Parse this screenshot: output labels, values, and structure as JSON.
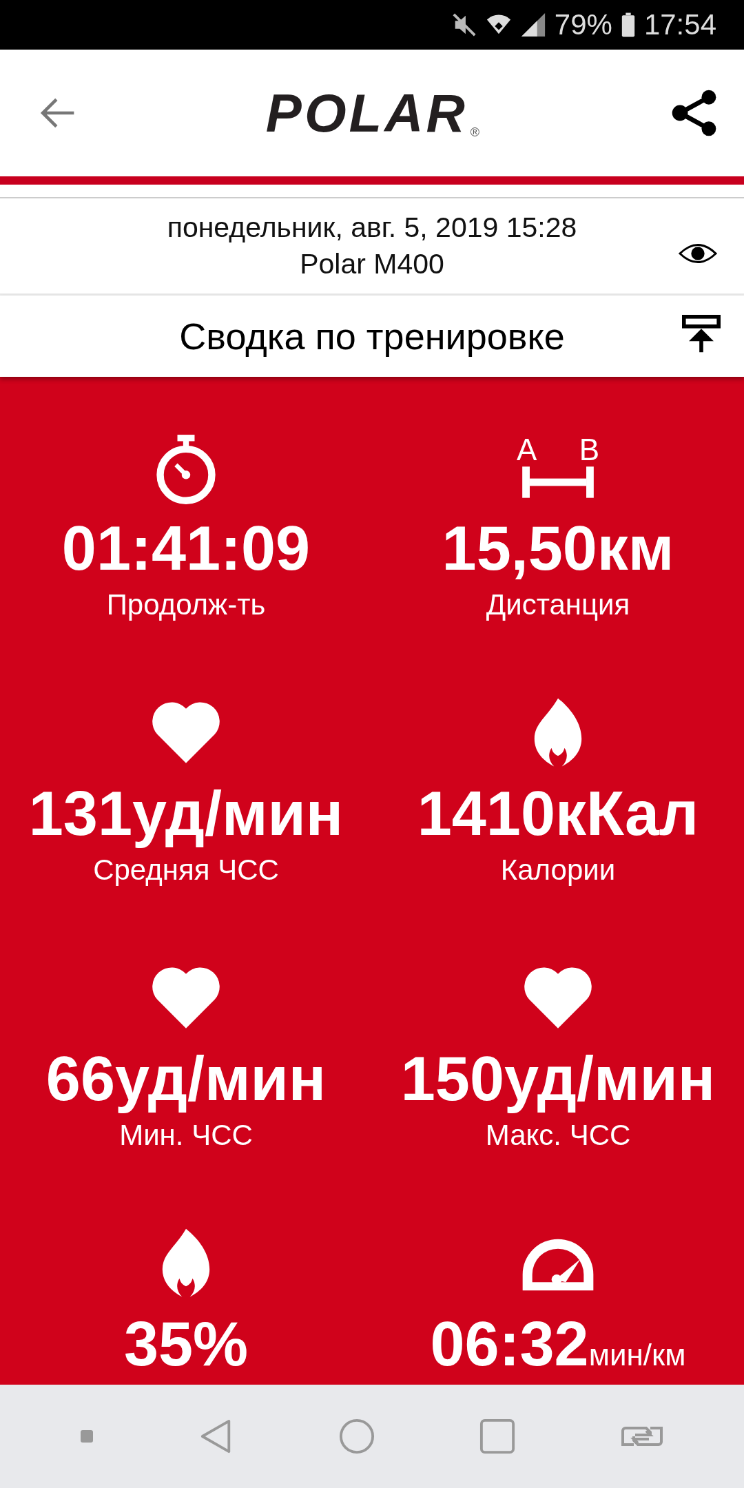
{
  "status_bar": {
    "battery": "79%",
    "time": "17:54"
  },
  "header": {
    "logo": "POLAR",
    "registered": "®"
  },
  "info": {
    "date": "понедельник, авг. 5, 2019 15:28",
    "device": "Polar M400"
  },
  "section": {
    "title": "Сводка по тренировке"
  },
  "distance_icon": {
    "marks": [
      "A",
      "B"
    ]
  },
  "stats": [
    {
      "kind": "stopwatch",
      "value": "01:41:09",
      "label": "Продолж-ть"
    },
    {
      "kind": "distance",
      "value": "15,50км",
      "label": "Дистанция"
    },
    {
      "kind": "heart",
      "value": "131уд/мин",
      "label": "Средняя ЧСС"
    },
    {
      "kind": "flame",
      "value": "1410кКал",
      "label": "Калории"
    },
    {
      "kind": "heart",
      "value": "66уд/мин",
      "label": "Мин. ЧСС"
    },
    {
      "kind": "heart",
      "value": "150уд/мин",
      "label": "Макс. ЧСС"
    },
    {
      "kind": "flame",
      "value": "35%"
    },
    {
      "kind": "gauge",
      "value": "06:32",
      "unit": "мин/км"
    }
  ]
}
